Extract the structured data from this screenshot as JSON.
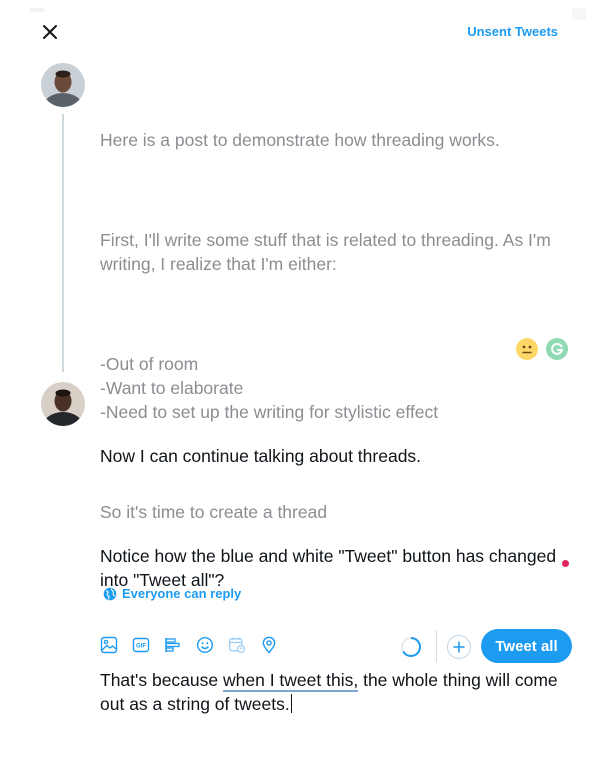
{
  "header": {
    "close_icon": "close-icon",
    "unsent_label": "Unsent Tweets"
  },
  "tweets": [
    {
      "paragraphs": [
        "Here is a post to demonstrate how threading works.",
        "First, I'll write some stuff that is related to threading. As I'm writing, I realize that I'm either:",
        "-Out of room\n-Want to elaborate\n-Need to set up the writing for stylistic effect",
        "So it's time to create a thread"
      ]
    },
    {
      "paragraphs": [
        "Now I can continue talking about threads.",
        "Notice how the blue and white \"Tweet\" button has changed into \"Tweet all\"?"
      ],
      "last_paragraph": {
        "before": "That's because ",
        "underlined": "when I tweet this,",
        "after": " the whole thing will come out as a string of tweets."
      }
    }
  ],
  "reply_setting": {
    "icon": "globe-icon",
    "label": "Everyone can reply"
  },
  "toolbar": {
    "icons": [
      "image-icon",
      "gif-icon",
      "poll-icon",
      "emoji-icon",
      "schedule-icon",
      "location-icon"
    ]
  },
  "actions": {
    "tweet_all_label": "Tweet all"
  },
  "colors": {
    "accent": "#1d9bf0",
    "faded_text": "#8a8d91",
    "text": "#0f1419"
  }
}
